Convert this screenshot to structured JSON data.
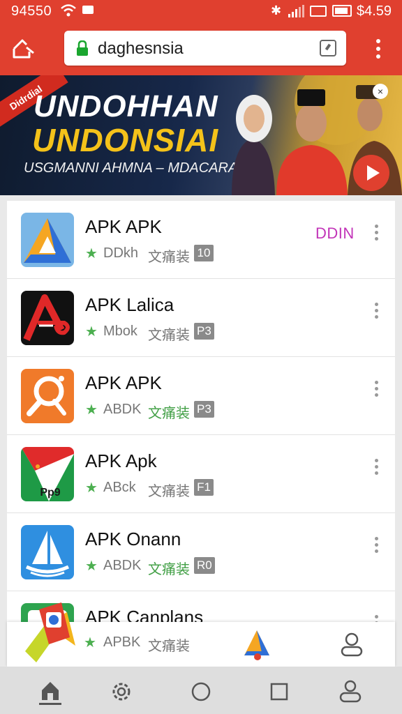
{
  "status_bar": {
    "time": "94550",
    "right_text": "$4.59",
    "icons": [
      "wifi-icon",
      "notification-icon",
      "bluetooth-icon",
      "signal-icon",
      "sim-icon",
      "battery-icon"
    ]
  },
  "browser": {
    "url": "daghesnsia",
    "icons": [
      "home-icon",
      "lock-icon",
      "tab-icon",
      "more-vert-icon"
    ]
  },
  "banner": {
    "ribbon": "Didrdial",
    "title_line1": "UNDOHHAN",
    "title_line2": "UNDONSIAI",
    "tagline": "USGMANNI AHMNA – MDACARAIN",
    "close": "×",
    "icons": [
      "play-icon",
      "close-icon"
    ]
  },
  "apps": [
    {
      "name": "APK APK",
      "dev": "DDkh",
      "category": "文痛装",
      "badge": "10",
      "action": "DDIN",
      "icon": "triangle-app-icon"
    },
    {
      "name": "APK Lalica",
      "dev": "Mbok",
      "category": "文痛装",
      "badge": "P3",
      "icon": "a-logo-app-icon"
    },
    {
      "name": "APK APK",
      "dev": "ABDK",
      "category": "文痛装",
      "badge": "P3",
      "icon": "search-app-icon"
    },
    {
      "name": "APK Apk",
      "dev": "ABck",
      "category": "文痛装",
      "badge": "F1",
      "icon": "flag-app-icon",
      "icon_text": "Pp9"
    },
    {
      "name": "APK Onann",
      "dev": "ABDK",
      "category": "文痛装",
      "badge": "R0",
      "icon": "sailboat-app-icon"
    },
    {
      "name": "APK Canplans",
      "icon": "colorful-app-icon"
    }
  ],
  "tab_bar": {
    "dev": "APBK",
    "category": "文痛装",
    "icons": [
      "ribbon-app-icon",
      "apk-logo-icon",
      "profile-icon"
    ]
  },
  "nav_bar": {
    "icons": [
      "home-icon",
      "settings-icon",
      "circle-home-icon",
      "recents-icon",
      "profile-icon"
    ]
  },
  "colors": {
    "accent": "#e0402f",
    "rating_star": "#4caf50",
    "action": "#c234b8",
    "badge": "#8a8a8a"
  }
}
